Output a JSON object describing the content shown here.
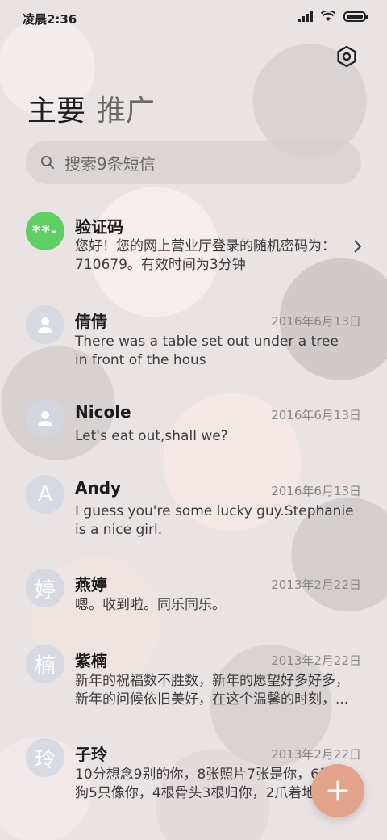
{
  "status_bar": {
    "time": "凌晨2:36"
  },
  "header": {
    "tabs": [
      {
        "label": "主要"
      },
      {
        "label": "推广"
      }
    ]
  },
  "search": {
    "placeholder": "搜索9条短信"
  },
  "messages": [
    {
      "name": "验证码",
      "avatar": "**-",
      "avatar_color": "#5fcf63",
      "date": "",
      "preview": "您好！您的网上营业厅登录的随机密码为：710679。有效时间为3分钟"
    },
    {
      "name": "倩倩",
      "avatar": "person-icon",
      "date": "2016年6月13日",
      "preview": "There was a table set out under a tree in front of the hous"
    },
    {
      "name": "Nicole",
      "avatar": "person-icon",
      "date": "2016年6月13日",
      "preview": "Let's eat out,shall we?"
    },
    {
      "name": "Andy",
      "avatar": "A",
      "date": "2016年6月13日",
      "preview": "I guess you're some lucky guy.Stephanie is a nice girl."
    },
    {
      "name": "燕婷",
      "avatar": "婷",
      "date": "2013年2月22日",
      "preview": "嗯。收到啦。同乐同乐。"
    },
    {
      "name": "紫楠",
      "avatar": "楠",
      "date": "2013年2月22日",
      "preview": "新年的祝福数不胜数，新年的愿望好多好多，新年的问候依旧美好，在这个温馨的时刻，..."
    },
    {
      "name": "子玲",
      "avatar": "玲",
      "date": "2013年2月22日",
      "preview": "10分想念9别的你，8张照片7张是你，6只小狗5只像你，4根骨头3根归你，2爪着地1..."
    }
  ],
  "colors": {
    "fab": "#e3a38a",
    "verify_avatar": "#5fcf63"
  },
  "icons": {
    "settings": "settings-icon",
    "search": "search-icon",
    "fab": "plus-icon",
    "chevron": "chevron-right-icon"
  }
}
